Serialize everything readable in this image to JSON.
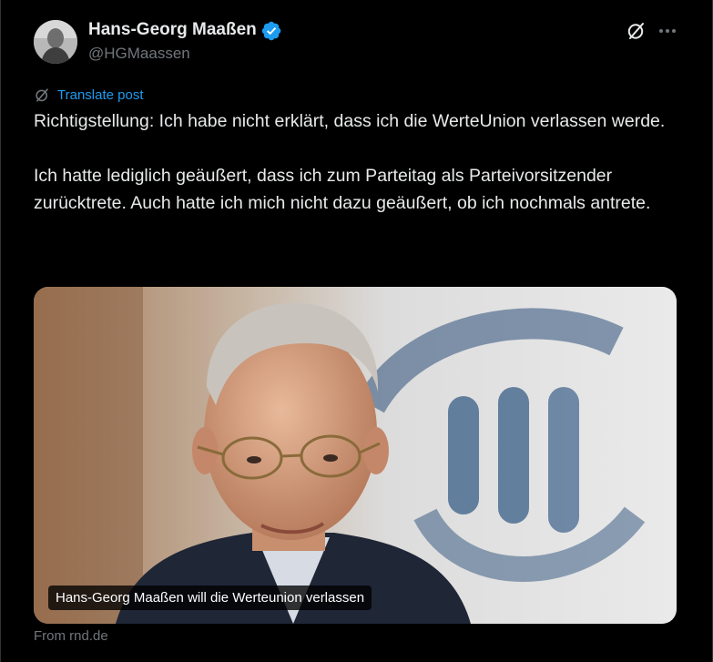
{
  "author": {
    "display_name": "Hans-Georg Maaßen",
    "handle": "@HGMaassen",
    "verified": true,
    "verified_color": "#1d9bf0"
  },
  "icons": {
    "avatar": "profile-photo",
    "verified": "verified-badge-icon",
    "grok": "grok-icon",
    "more": "more-options-icon",
    "translate": "translate-icon"
  },
  "post": {
    "translate_label": "Translate post",
    "paragraph_1": "Richtigstellung: Ich habe nicht erklärt, dass ich die WerteUnion verlassen werde.",
    "paragraph_2": "Ich hatte lediglich geäußert, dass ich zum Parteitag als Parteivorsitzender zurücktrete. Auch hatte ich mich nicht dazu geäußert, ob ich nochmals antrete."
  },
  "link_card": {
    "caption": "Hans-Georg Maaßen will die Werteunion verlassen",
    "source": "From rnd.de"
  },
  "colors": {
    "background": "#000000",
    "text": "#e7e9ea",
    "secondary": "#71767b",
    "link": "#1d9bf0"
  }
}
